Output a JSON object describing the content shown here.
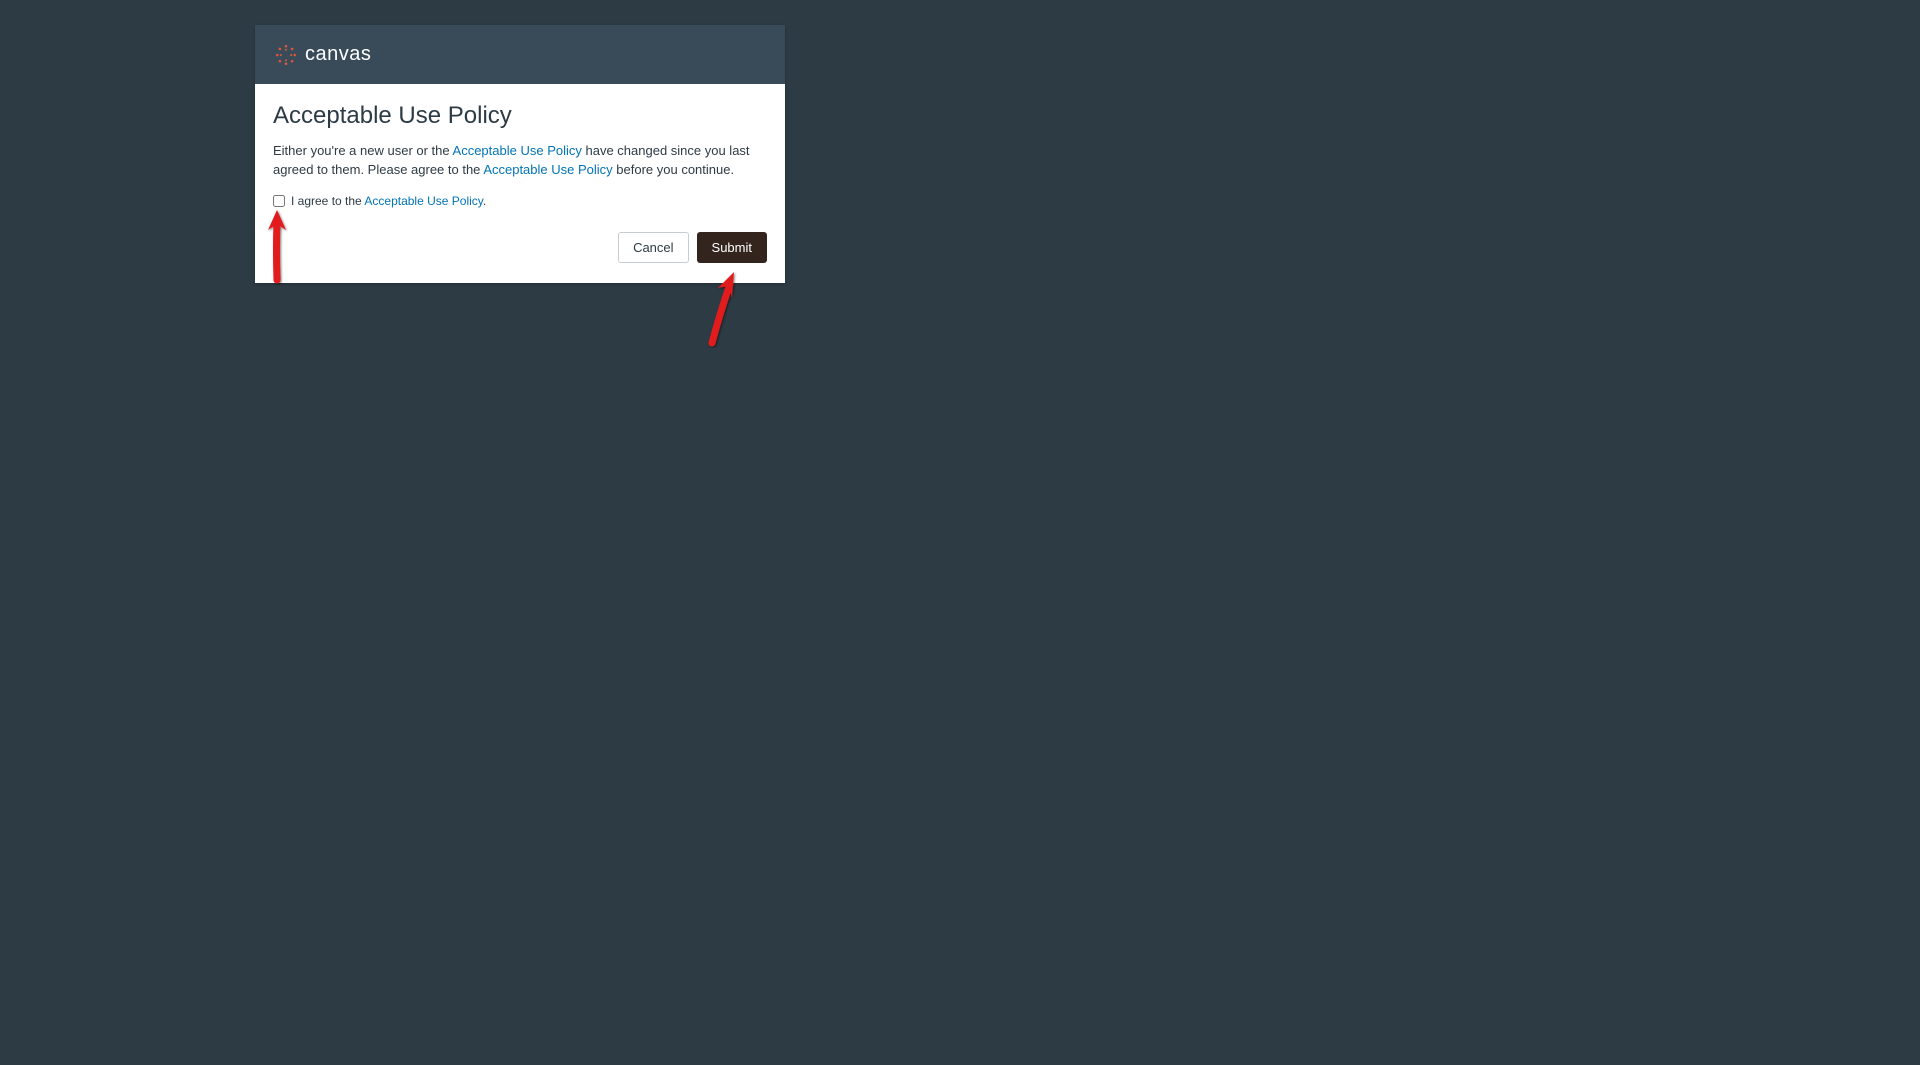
{
  "header": {
    "logo_text": "canvas"
  },
  "policy": {
    "title": "Acceptable Use Policy",
    "desc_prefix": "Either you're a new user or the ",
    "desc_link1": "Acceptable Use Policy",
    "desc_middle": " have changed since you last agreed to them. Please agree to the ",
    "desc_link2": "Acceptable Use Policy",
    "desc_suffix": " before you continue.",
    "agree_prefix": "I agree to the ",
    "agree_link": "Acceptable Use Policy",
    "agree_suffix": "."
  },
  "buttons": {
    "cancel": "Cancel",
    "submit": "Submit"
  }
}
